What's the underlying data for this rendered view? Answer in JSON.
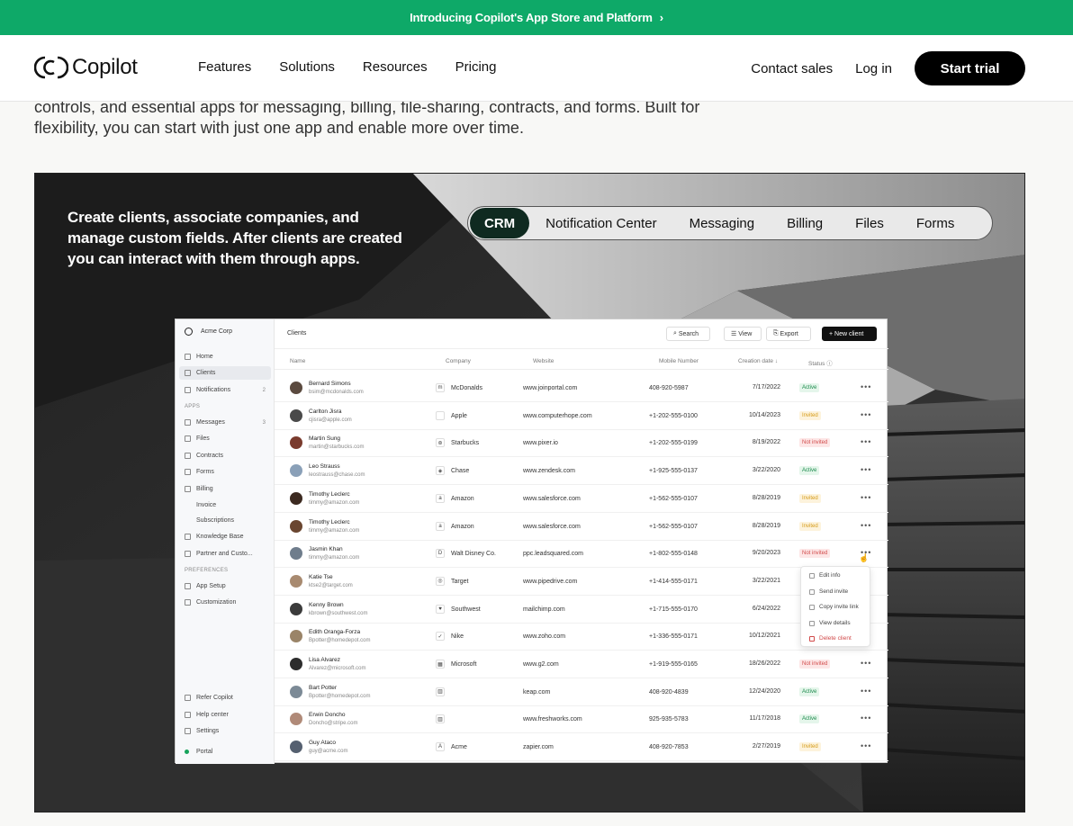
{
  "banner": {
    "text": "Introducing Copilot's App Store and Platform",
    "chevron": "›"
  },
  "nav": {
    "logo": "Copilot",
    "menu": [
      "Features",
      "Solutions",
      "Resources",
      "Pricing"
    ],
    "contact_sales": "Contact sales",
    "log_in": "Log in",
    "start_trial": "Start trial"
  },
  "intro": {
    "line1": "controls, and essential apps for messaging, billing, file-sharing, contracts, and forms. Built for",
    "line2": "flexibility, you can start with just one app and enable more over time."
  },
  "hero": {
    "copy": "Create clients, associate companies, and manage custom fields. After clients are created you can interact with them through apps.",
    "tabs": [
      "CRM",
      "Notification Center",
      "Messaging",
      "Billing",
      "Files",
      "Forms"
    ],
    "active_tab": "CRM"
  },
  "app": {
    "org": "Acme Corp",
    "sidebar": {
      "items": [
        {
          "label": "Home",
          "count": ""
        },
        {
          "label": "Clients",
          "count": ""
        },
        {
          "label": "Notifications",
          "count": "2"
        }
      ],
      "apps_header": "APPS",
      "apps": [
        {
          "label": "Messages",
          "count": "3"
        },
        {
          "label": "Files",
          "count": ""
        },
        {
          "label": "Contracts",
          "count": ""
        },
        {
          "label": "Forms",
          "count": ""
        },
        {
          "label": "Billing",
          "count": ""
        },
        {
          "label": "Invoice",
          "count": ""
        },
        {
          "label": "Subscriptions",
          "count": ""
        },
        {
          "label": "Knowledge Base",
          "count": ""
        },
        {
          "label": "Partner and Custo...",
          "count": ""
        }
      ],
      "prefs_header": "PREFERENCES",
      "prefs": [
        {
          "label": "App Setup"
        },
        {
          "label": "Customization"
        }
      ],
      "bottom": [
        {
          "label": "Refer Copilot"
        },
        {
          "label": "Help center"
        },
        {
          "label": "Settings"
        }
      ],
      "portal": "Portal"
    },
    "toolbar": {
      "title": "Clients",
      "search": "Search",
      "view": "View",
      "export": "Export",
      "new_client": "+ New client"
    },
    "columns": [
      "Name",
      "Company",
      "Website",
      "Mobile Number",
      "Creation date ↓",
      "Status ⓘ"
    ],
    "rows": [
      {
        "name": "Bernard Simons",
        "email": "bsim@mcdonalds.com",
        "logo": "m",
        "company": "McDonalds",
        "website": "www.joinportal.com",
        "phone": "408-920-5987",
        "date": "7/17/2022",
        "status": "Active"
      },
      {
        "name": "Carlton Jisra",
        "email": "cjisra@apple.com",
        "logo": "",
        "company": "Apple",
        "website": "www.computerhope.com",
        "phone": "+1-202-555-0100",
        "date": "10/14/2023",
        "status": "Invited"
      },
      {
        "name": "Martin Sung",
        "email": "martin@starbucks.com",
        "logo": "⊛",
        "company": "Starbucks",
        "website": "www.pixer.io",
        "phone": "+1-202-555-0199",
        "date": "8/19/2022",
        "status": "Not invited"
      },
      {
        "name": "Leo Strauss",
        "email": "leostrauss@chase.com",
        "logo": "◈",
        "company": "Chase",
        "website": "www.zendesk.com",
        "phone": "+1-925-555-0137",
        "date": "3/22/2020",
        "status": "Active"
      },
      {
        "name": "Timothy Leclerc",
        "email": "timmy@amazon.com",
        "logo": "a",
        "company": "Amazon",
        "website": "www.salesforce.com",
        "phone": "+1-562-555-0107",
        "date": "8/28/2019",
        "status": "Invited"
      },
      {
        "name": "Timothy Leclerc",
        "email": "timmy@amazon.com",
        "logo": "a",
        "company": "Amazon",
        "website": "www.salesforce.com",
        "phone": "+1-562-555-0107",
        "date": "8/28/2019",
        "status": "Invited"
      },
      {
        "name": "Jasmin Khan",
        "email": "timmy@amazon.com",
        "logo": "D",
        "company": "Walt Disney Co.",
        "website": "ppc.leadsquared.com",
        "phone": "+1-802-555-0148",
        "date": "9/20/2023",
        "status": "Not invited"
      },
      {
        "name": "Katie Tse",
        "email": "ktse2@target.com",
        "logo": "◎",
        "company": "Target",
        "website": "www.pipedrive.com",
        "phone": "+1-414-555-0171",
        "date": "3/22/2021",
        "status": ""
      },
      {
        "name": "Kenny Brown",
        "email": "kbrown@southwest.com",
        "logo": "♥",
        "company": "Southwest",
        "website": "mailchimp.com",
        "phone": "+1-715-555-0170",
        "date": "6/24/2022",
        "status": ""
      },
      {
        "name": "Edith Oranga-Forza",
        "email": "Bpotter@homedepot.com",
        "logo": "✓",
        "company": "Nike",
        "website": "www.zoho.com",
        "phone": "+1-336-555-0171",
        "date": "10/12/2021",
        "status": ""
      },
      {
        "name": "Lisa Alvarez",
        "email": "Alvarez@microsoft.com",
        "logo": "▦",
        "company": "Microsoft",
        "website": "www.g2.com",
        "phone": "+1-919-555-0165",
        "date": "18/26/2022",
        "status": "Not invited"
      },
      {
        "name": "Bart Potter",
        "email": "Bpotter@homedepot.com",
        "logo": "▥",
        "company": "",
        "website": "keap.com",
        "phone": "408-920-4839",
        "date": "12/24/2020",
        "status": "Active"
      },
      {
        "name": "Erwin Doncho",
        "email": "Doncho@stripe.com",
        "logo": "▥",
        "company": "",
        "website": "www.freshworks.com",
        "phone": "925-935-5783",
        "date": "11/17/2018",
        "status": "Active"
      },
      {
        "name": "Guy Ataco",
        "email": "guy@acme.com",
        "logo": "A",
        "company": "Acme",
        "website": "zapier.com",
        "phone": "408-920-7853",
        "date": "2/27/2019",
        "status": "Invited"
      }
    ],
    "context_menu": [
      "Edit info",
      "Send invite",
      "Copy invite link",
      "View details",
      "Delete client"
    ]
  }
}
